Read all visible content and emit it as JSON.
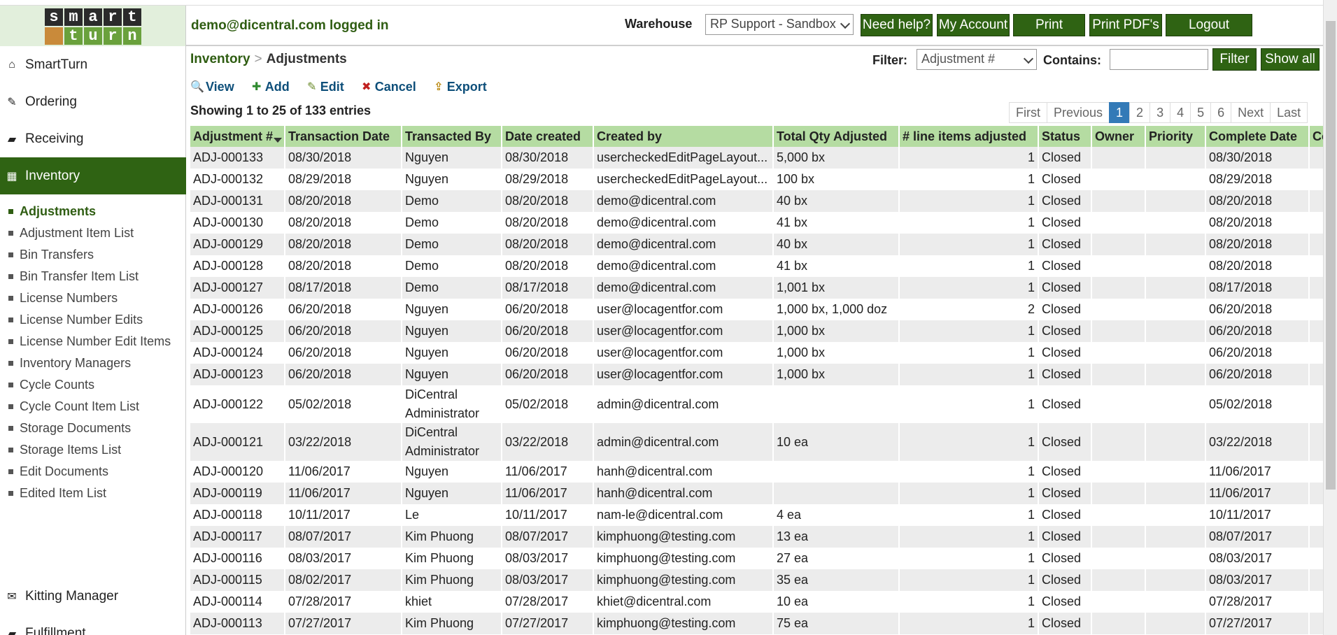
{
  "logo": {
    "row1": [
      "s",
      "m",
      "a",
      "r",
      "t"
    ],
    "row2": [
      "",
      "t",
      "u",
      "r",
      "n"
    ]
  },
  "header": {
    "logged_in": "demo@dicentral.com logged in",
    "warehouse_label": "Warehouse",
    "warehouse_value": "RP Support - Sandbox",
    "buttons": [
      "Need help?",
      "My Account",
      "Print",
      "Print PDF's",
      "Logout"
    ]
  },
  "sidebar": {
    "top": [
      {
        "label": "SmartTurn",
        "icon": "home-icon"
      },
      {
        "label": "Ordering",
        "icon": "edit-icon"
      },
      {
        "label": "Receiving",
        "icon": "truck-icon"
      }
    ],
    "active": {
      "label": "Inventory",
      "icon": "warehouse-icon"
    },
    "sub": [
      "Adjustments",
      "Adjustment Item List",
      "Bin Transfers",
      "Bin Transfer Item List",
      "License Numbers",
      "License Number Edits",
      "License Number Edit Items",
      "Inventory Managers",
      "Cycle Counts",
      "Cycle Count Item List",
      "Storage Documents",
      "Storage Items List",
      "Edit Documents",
      "Edited Item List"
    ],
    "bottom": [
      {
        "label": "Kitting Manager",
        "icon": "gift-icon"
      },
      {
        "label": "Fulfillment",
        "icon": "truck-icon"
      }
    ]
  },
  "breadcrumb": {
    "parent": "Inventory",
    "separator": ">",
    "current": "Adjustments"
  },
  "filter": {
    "label": "Filter:",
    "value": "Adjustment #",
    "contains_label": "Contains:",
    "contains_value": "",
    "filter_button": "Filter",
    "show_all_button": "Show all"
  },
  "toolbar": [
    "View",
    "Add",
    "Edit",
    "Cancel",
    "Export"
  ],
  "showing": "Showing 1 to 25 of 133 entries",
  "pager": [
    "First",
    "Previous",
    "1",
    "2",
    "3",
    "4",
    "5",
    "6",
    "Next",
    "Last"
  ],
  "pager_active": "1",
  "table": {
    "columns": [
      "Adjustment #",
      "Transaction Date",
      "Transacted By",
      "Date created",
      "Created by",
      "Total Qty Adjusted",
      "# line items adjusted",
      "Status",
      "Owner",
      "Priority",
      "Complete Date",
      "Co"
    ],
    "rows": [
      [
        "ADJ-000133",
        "08/30/2018",
        "Nguyen",
        "08/30/2018",
        "usercheckedEditPageLayout...",
        "5,000 bx",
        "1",
        "Closed",
        "",
        "",
        "08/30/2018",
        ""
      ],
      [
        "ADJ-000132",
        "08/29/2018",
        "Nguyen",
        "08/29/2018",
        "usercheckedEditPageLayout...",
        "100 bx",
        "1",
        "Closed",
        "",
        "",
        "08/29/2018",
        ""
      ],
      [
        "ADJ-000131",
        "08/20/2018",
        "Demo",
        "08/20/2018",
        "demo@dicentral.com",
        "40 bx",
        "1",
        "Closed",
        "",
        "",
        "08/20/2018",
        ""
      ],
      [
        "ADJ-000130",
        "08/20/2018",
        "Demo",
        "08/20/2018",
        "demo@dicentral.com",
        "41 bx",
        "1",
        "Closed",
        "",
        "",
        "08/20/2018",
        ""
      ],
      [
        "ADJ-000129",
        "08/20/2018",
        "Demo",
        "08/20/2018",
        "demo@dicentral.com",
        "40 bx",
        "1",
        "Closed",
        "",
        "",
        "08/20/2018",
        ""
      ],
      [
        "ADJ-000128",
        "08/20/2018",
        "Demo",
        "08/20/2018",
        "demo@dicentral.com",
        "41 bx",
        "1",
        "Closed",
        "",
        "",
        "08/20/2018",
        ""
      ],
      [
        "ADJ-000127",
        "08/17/2018",
        "Demo",
        "08/17/2018",
        "demo@dicentral.com",
        "1,001 bx",
        "1",
        "Closed",
        "",
        "",
        "08/17/2018",
        ""
      ],
      [
        "ADJ-000126",
        "06/20/2018",
        "Nguyen",
        "06/20/2018",
        "user@locagentfor.com",
        "1,000 bx, 1,000 doz",
        "2",
        "Closed",
        "",
        "",
        "06/20/2018",
        ""
      ],
      [
        "ADJ-000125",
        "06/20/2018",
        "Nguyen",
        "06/20/2018",
        "user@locagentfor.com",
        "1,000 bx",
        "1",
        "Closed",
        "",
        "",
        "06/20/2018",
        ""
      ],
      [
        "ADJ-000124",
        "06/20/2018",
        "Nguyen",
        "06/20/2018",
        "user@locagentfor.com",
        "1,000 bx",
        "1",
        "Closed",
        "",
        "",
        "06/20/2018",
        ""
      ],
      [
        "ADJ-000123",
        "06/20/2018",
        "Nguyen",
        "06/20/2018",
        "user@locagentfor.com",
        "1,000 bx",
        "1",
        "Closed",
        "",
        "",
        "06/20/2018",
        ""
      ],
      [
        "ADJ-000122",
        "05/02/2018",
        "DiCentral Administrator",
        "05/02/2018",
        "admin@dicentral.com",
        "",
        "1",
        "Closed",
        "",
        "",
        "05/02/2018",
        ""
      ],
      [
        "ADJ-000121",
        "03/22/2018",
        "DiCentral Administrator",
        "03/22/2018",
        "admin@dicentral.com",
        "10 ea",
        "1",
        "Closed",
        "",
        "",
        "03/22/2018",
        ""
      ],
      [
        "ADJ-000120",
        "11/06/2017",
        "Nguyen",
        "11/06/2017",
        "hanh@dicentral.com",
        "",
        "1",
        "Closed",
        "",
        "",
        "11/06/2017",
        ""
      ],
      [
        "ADJ-000119",
        "11/06/2017",
        "Nguyen",
        "11/06/2017",
        "hanh@dicentral.com",
        "",
        "1",
        "Closed",
        "",
        "",
        "11/06/2017",
        ""
      ],
      [
        "ADJ-000118",
        "10/11/2017",
        "Le",
        "10/11/2017",
        "nam-le@dicentral.com",
        "4 ea",
        "1",
        "Closed",
        "",
        "",
        "10/11/2017",
        ""
      ],
      [
        "ADJ-000117",
        "08/07/2017",
        "Kim Phuong",
        "08/07/2017",
        "kimphuong@testing.com",
        "13 ea",
        "1",
        "Closed",
        "",
        "",
        "08/07/2017",
        ""
      ],
      [
        "ADJ-000116",
        "08/03/2017",
        "Kim Phuong",
        "08/03/2017",
        "kimphuong@testing.com",
        "27 ea",
        "1",
        "Closed",
        "",
        "",
        "08/03/2017",
        ""
      ],
      [
        "ADJ-000115",
        "08/02/2017",
        "Kim Phuong",
        "08/03/2017",
        "kimphuong@testing.com",
        "35 ea",
        "1",
        "Closed",
        "",
        "",
        "08/03/2017",
        ""
      ],
      [
        "ADJ-000114",
        "07/28/2017",
        "khiet",
        "07/28/2017",
        "khiet@dicentral.com",
        "10 ea",
        "1",
        "Closed",
        "",
        "",
        "07/28/2017",
        ""
      ],
      [
        "ADJ-000113",
        "07/27/2017",
        "Kim Phuong",
        "07/27/2017",
        "kimphuong@testing.com",
        "75 ea",
        "1",
        "Closed",
        "",
        "",
        "07/27/2017",
        ""
      ]
    ]
  }
}
